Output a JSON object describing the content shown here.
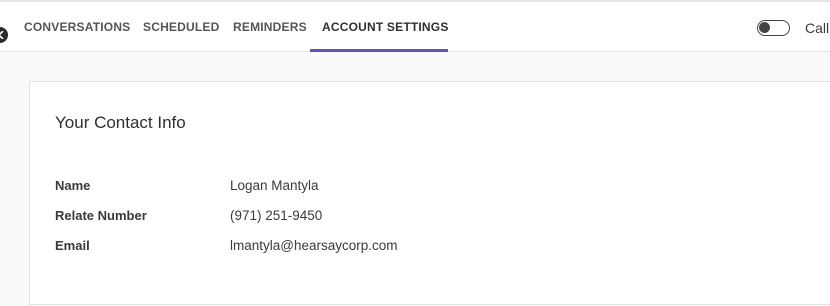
{
  "tabs": [
    {
      "label": "CONVERSATIONS",
      "active": false
    },
    {
      "label": "SCHEDULED",
      "active": false
    },
    {
      "label": "REMINDERS",
      "active": false
    },
    {
      "label": "ACCOUNT SETTINGS",
      "active": true
    }
  ],
  "toggle": {
    "label": "Call",
    "on": false
  },
  "accent_color": "#5a4fd6",
  "card": {
    "title": "Your Contact Info",
    "rows": [
      {
        "label": "Name",
        "value": "Logan Mantyla"
      },
      {
        "label": "Relate Number",
        "value": "(971) 251-9450"
      },
      {
        "label": "Email",
        "value": "lmantyla@hearsaycorp.com"
      }
    ]
  }
}
